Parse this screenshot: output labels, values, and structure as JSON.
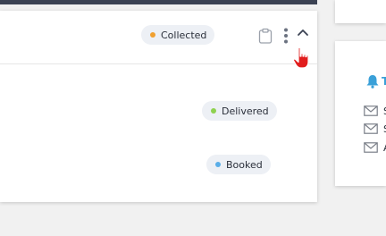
{
  "main_card": {
    "header_badge": {
      "label": "Collected",
      "dot_color": "#f0a030"
    },
    "rows": [
      {
        "status": "Delivered",
        "dot_color": "#8fd14f"
      },
      {
        "status": "Booked",
        "dot_color": "#5aaee8"
      }
    ],
    "icons": [
      "clipboard-icon",
      "kebab-menu-icon",
      "chevron-up-icon",
      "hand-pointer-cursor-icon"
    ]
  },
  "side_panel": {
    "title_prefix": "T",
    "title_icon": "bell-icon",
    "items": [
      {
        "icon": "envelope-icon",
        "text": "S"
      },
      {
        "icon": "envelope-icon",
        "text": "S"
      },
      {
        "icon": "envelope-icon",
        "text": "A"
      }
    ]
  },
  "colors": {
    "top_bar": "#3b4253",
    "accent": "#3aa0d8",
    "badge_bg": "#edf0f5"
  }
}
